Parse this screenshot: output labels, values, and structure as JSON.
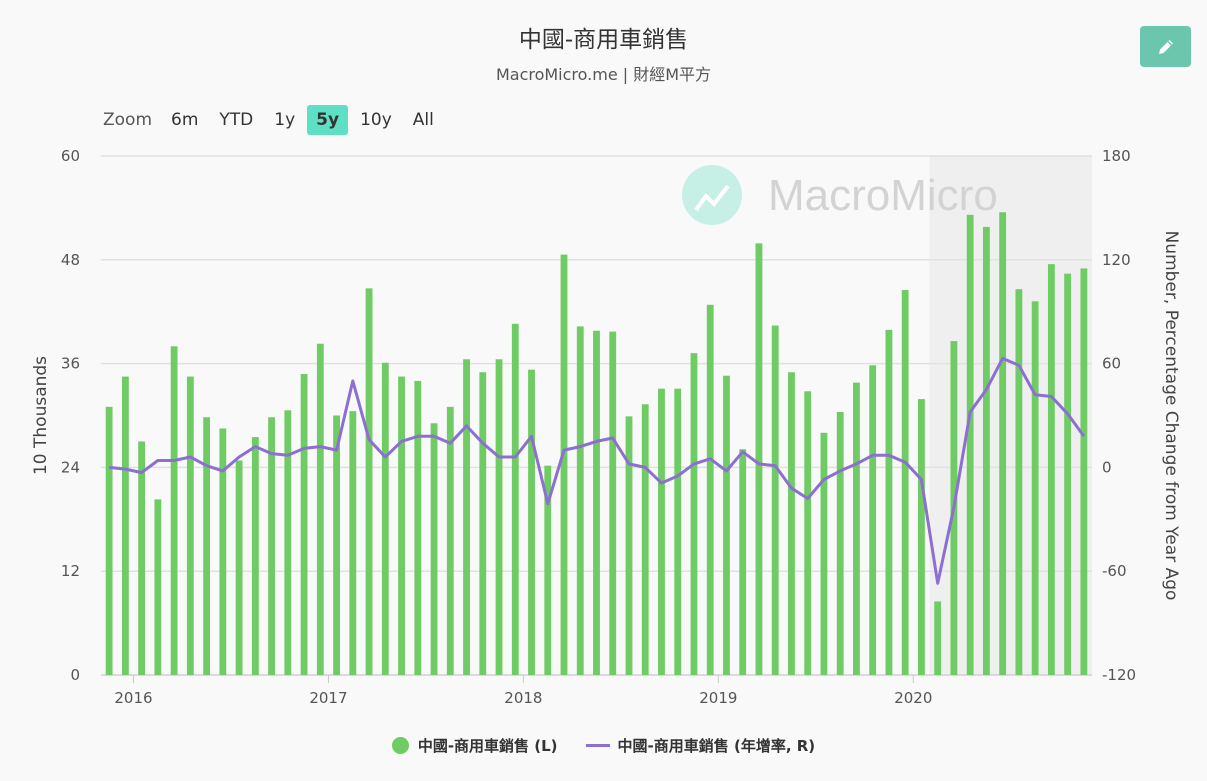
{
  "title": "中國-商用車銷售",
  "subtitle": "MacroMicro.me | 財經M平方",
  "watermark": "MacroMicro",
  "zoom": {
    "label": "Zoom",
    "buttons": [
      "6m",
      "YTD",
      "1y",
      "5y",
      "10y",
      "All"
    ],
    "active": "5y"
  },
  "edit_icon": "pencil-icon",
  "colors": {
    "bars": "#6fcb63",
    "line": "#8d6fd1",
    "shade": "#efefef",
    "watermark_logo": "#c6f0e6"
  },
  "legend": {
    "bars_label": "中國-商用車銷售 (L)",
    "line_label": "中國-商用車銷售 (年增率, R)"
  },
  "chart_data": {
    "type": "bar+line",
    "x_start": "2015-11",
    "x_ticks": [
      "2016",
      "2017",
      "2018",
      "2019",
      "2020"
    ],
    "left_axis": {
      "label": "10 Thousands",
      "range": [
        0,
        60
      ],
      "ticks": [
        0,
        12,
        24,
        36,
        48,
        60
      ]
    },
    "right_axis": {
      "label": "Number, Percentage Change from Year Ago",
      "range": [
        -120,
        180
      ],
      "ticks": [
        -120,
        -60,
        0,
        60,
        120,
        180
      ]
    },
    "shaded_period": [
      "2020-02",
      "2020-10"
    ],
    "series": [
      {
        "name": "中國-商用車銷售 (L)",
        "type": "bar",
        "values": [
          31,
          34.5,
          27,
          20.3,
          38,
          34.5,
          29.8,
          28.5,
          24.8,
          27.5,
          29.8,
          30.6,
          34.8,
          38.3,
          30,
          30.5,
          44.7,
          36.1,
          34.5,
          34,
          29.1,
          31,
          36.5,
          35,
          36.5,
          40.6,
          35.3,
          24.2,
          48.6,
          40.3,
          39.8,
          39.7,
          29.9,
          31.3,
          33.1,
          33.1,
          37.2,
          42.8,
          34.6,
          26.1,
          49.9,
          40.4,
          35,
          32.8,
          28,
          30.4,
          33.8,
          35.8,
          39.9,
          44.5,
          31.9,
          8.5,
          38.6,
          53.2,
          51.8,
          53.5,
          44.6,
          43.2,
          47.5,
          46.4,
          47
        ]
      },
      {
        "name": "中國-商用車銷售 (年增率, R)",
        "type": "line",
        "values": [
          0,
          -1,
          -3,
          4,
          4,
          6,
          1,
          -2,
          6,
          12,
          8,
          7,
          11,
          12,
          10,
          50,
          16,
          6,
          15,
          18,
          18,
          14,
          24,
          14,
          6,
          6,
          18,
          -21,
          10,
          12,
          15,
          17,
          2,
          0,
          -9,
          -5,
          2,
          5,
          -2,
          9,
          2,
          1,
          -12,
          -18,
          -7,
          -2,
          2,
          7,
          7,
          3,
          -7,
          -67,
          -23,
          32,
          45,
          63,
          59,
          42,
          41,
          31,
          18
        ]
      }
    ]
  }
}
